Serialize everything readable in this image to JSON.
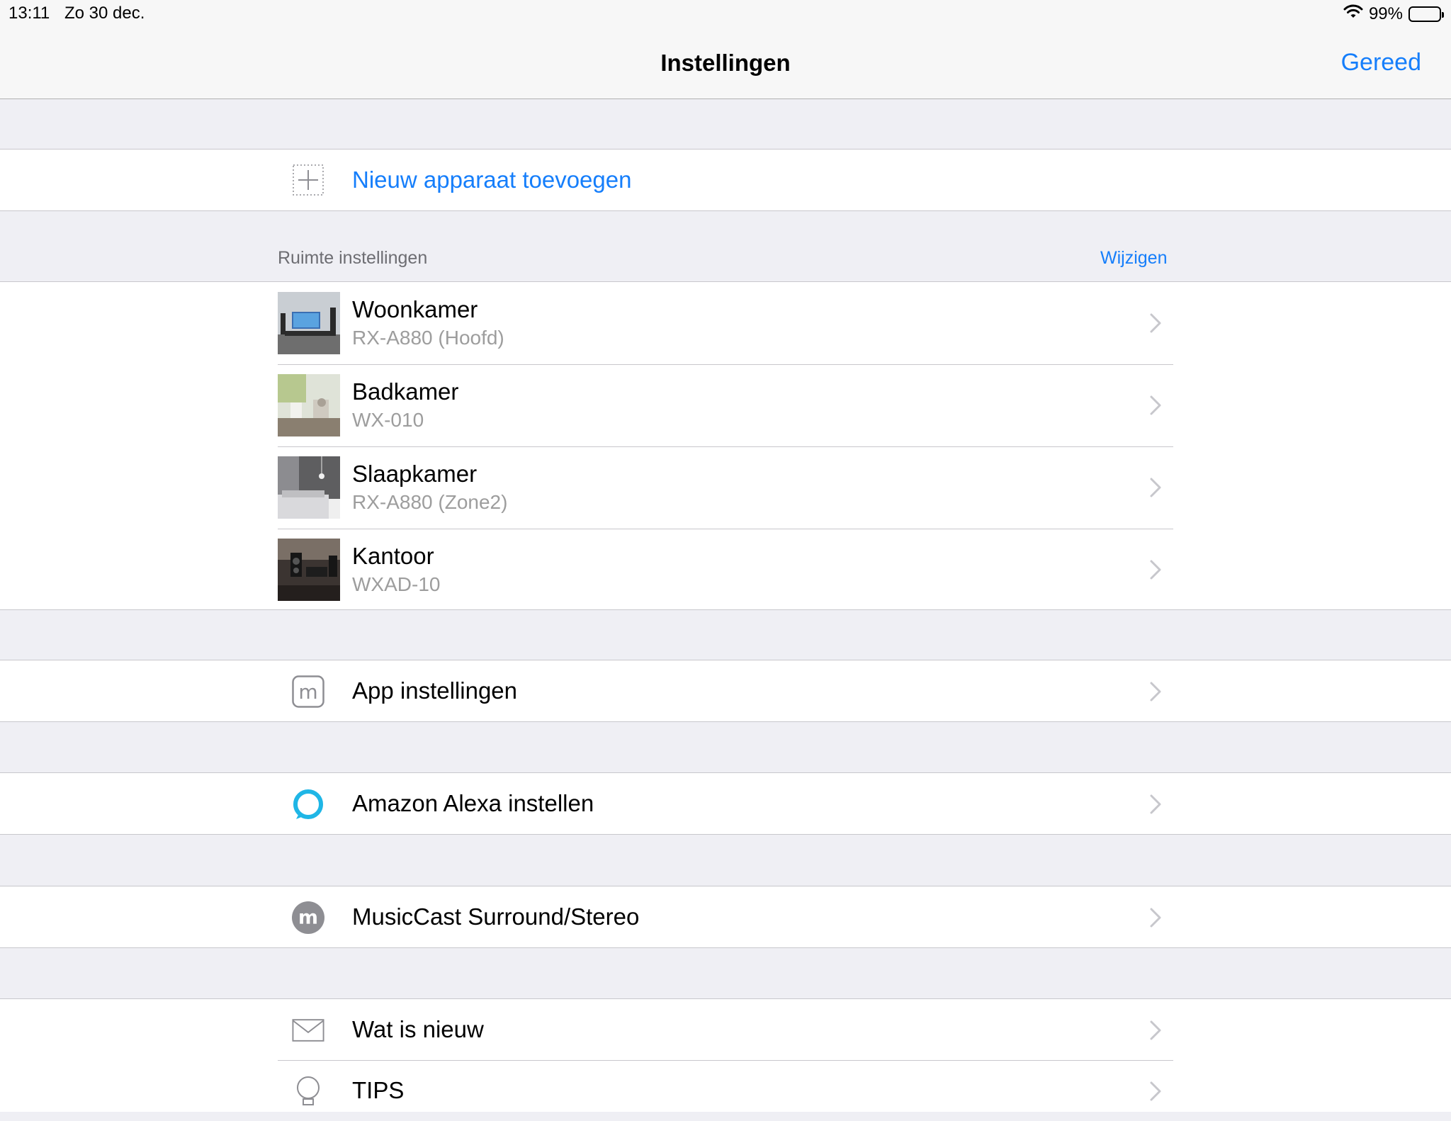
{
  "status_bar": {
    "time": "13:11",
    "date": "Zo 30 dec.",
    "battery": "99%"
  },
  "nav": {
    "title": "Instellingen",
    "done_label": "Gereed"
  },
  "add_device": {
    "label": "Nieuw apparaat toevoegen",
    "icon": "plus-icon"
  },
  "rooms_section": {
    "header": "Ruimte instellingen",
    "edit_label": "Wijzigen",
    "rooms": [
      {
        "name": "Woonkamer",
        "model": "RX-A880 (Hoofd)"
      },
      {
        "name": "Badkamer",
        "model": "WX-010"
      },
      {
        "name": "Slaapkamer",
        "model": "RX-A880 (Zone2)"
      },
      {
        "name": "Kantoor",
        "model": "WXAD-10"
      }
    ]
  },
  "menu": {
    "app_settings": {
      "label": "App instellingen",
      "icon": "musiccast-app-icon"
    },
    "alexa": {
      "label": "Amazon Alexa instellen",
      "icon": "alexa-ring-icon"
    },
    "surround": {
      "label": "MusicCast Surround/Stereo",
      "icon": "musiccast-circle-icon"
    },
    "whats_new": {
      "label": "Wat is nieuw",
      "icon": "envelope-icon"
    },
    "tips": {
      "label": "TIPS",
      "icon": "lightbulb-icon"
    }
  },
  "colors": {
    "accent": "#157efb",
    "background": "#efeff4",
    "alexa": "#1fb6e6"
  }
}
